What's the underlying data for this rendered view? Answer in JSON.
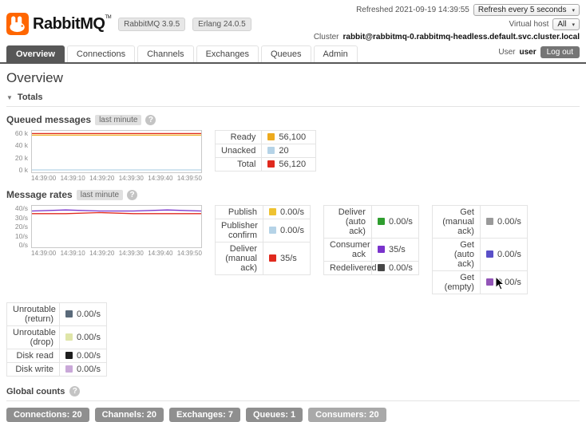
{
  "header": {
    "brand": "RabbitMQ",
    "brand_tm": "TM",
    "version_badge": "RabbitMQ 3.9.5",
    "erlang_badge": "Erlang 24.0.5",
    "refreshed": "Refreshed 2021-09-19 14:39:55",
    "refresh_select": "Refresh every 5 seconds",
    "virtual_host_label": "Virtual host",
    "virtual_host_select": "All",
    "cluster_label": "Cluster",
    "cluster_value": "rabbit@rabbitmq-0.rabbitmq-headless.default.svc.cluster.local",
    "user_label": "User",
    "user_value": "user",
    "logout": "Log out"
  },
  "tabs": [
    {
      "label": "Overview"
    },
    {
      "label": "Connections"
    },
    {
      "label": "Channels"
    },
    {
      "label": "Exchanges"
    },
    {
      "label": "Queues"
    },
    {
      "label": "Admin"
    }
  ],
  "page_title": "Overview",
  "totals": {
    "title": "Totals"
  },
  "queued": {
    "title": "Queued messages",
    "badge": "last minute",
    "help": "?",
    "legend": [
      {
        "label": "Ready",
        "value": "56,100",
        "color": "#edaa1e"
      },
      {
        "label": "Unacked",
        "value": "20",
        "color": "#b5d3e7"
      },
      {
        "label": "Total",
        "value": "56,120",
        "color": "#e02a1e"
      }
    ]
  },
  "rates": {
    "title": "Message rates",
    "badge": "last minute",
    "help": "?",
    "groups": [
      [
        {
          "label": "Publish",
          "value": "0.00/s",
          "color": "#eec231"
        },
        {
          "label": "Publisher confirm",
          "value": "0.00/s",
          "color": "#b5d3e7"
        },
        {
          "label": "Deliver (manual ack)",
          "value": "35/s",
          "color": "#e02a1e"
        }
      ],
      [
        {
          "label": "Deliver (auto ack)",
          "value": "0.00/s",
          "color": "#2f9e2f"
        },
        {
          "label": "Consumer ack",
          "value": "35/s",
          "color": "#7a33cc"
        },
        {
          "label": "Redelivered",
          "value": "0.00/s",
          "color": "#474747"
        }
      ],
      [
        {
          "label": "Get (manual ack)",
          "value": "0.00/s",
          "color": "#9a9a9a"
        },
        {
          "label": "Get (auto ack)",
          "value": "0.00/s",
          "color": "#5a50c8"
        },
        {
          "label": "Get (empty)",
          "value": "0.00/s",
          "color": "#9355b8"
        }
      ]
    ],
    "extra": [
      {
        "label": "Unroutable (return)",
        "value": "0.00/s",
        "color": "#5a6a7a"
      },
      {
        "label": "Unroutable (drop)",
        "value": "0.00/s",
        "color": "#dfe5a8"
      },
      {
        "label": "Disk read",
        "value": "0.00/s",
        "color": "#1e1e1e"
      },
      {
        "label": "Disk write",
        "value": "0.00/s",
        "color": "#c9a8d8"
      }
    ]
  },
  "global_counts": {
    "title": "Global counts",
    "help": "?",
    "badges": [
      {
        "text": "Connections: 20"
      },
      {
        "text": "Channels: 20"
      },
      {
        "text": "Exchanges: 7"
      },
      {
        "text": "Queues: 1"
      },
      {
        "text": "Consumers: 20"
      }
    ]
  },
  "chart_data": [
    {
      "type": "line",
      "title": "Queued messages (last minute)",
      "x": [
        "14:39:00",
        "14:39:10",
        "14:39:20",
        "14:39:30",
        "14:39:40",
        "14:39:50"
      ],
      "ylim": [
        0,
        60000
      ],
      "yticks": [
        "60 k",
        "40 k",
        "20 k",
        "0 k"
      ],
      "series": [
        {
          "name": "Total",
          "color": "#e02a1e",
          "values": [
            56120,
            56120,
            56120,
            56120,
            56120,
            56120
          ]
        },
        {
          "name": "Ready",
          "color": "#edaa1e",
          "values": [
            56100,
            56100,
            56100,
            56100,
            56100,
            56100
          ]
        },
        {
          "name": "Unacked",
          "color": "#b5d3e7",
          "values": [
            20,
            20,
            20,
            20,
            20,
            20
          ]
        }
      ]
    },
    {
      "type": "line",
      "title": "Message rates (last minute)",
      "x": [
        "14:39:00",
        "14:39:10",
        "14:39:20",
        "14:39:30",
        "14:39:40",
        "14:39:50"
      ],
      "ylim": [
        0,
        40
      ],
      "yticks": [
        "40/s",
        "30/s",
        "20/s",
        "10/s",
        "0/s"
      ],
      "series": [
        {
          "name": "Consumer ack",
          "color": "#7a33cc",
          "values": [
            35,
            36,
            35,
            35,
            36,
            35
          ]
        },
        {
          "name": "Deliver (manual ack)",
          "color": "#e02a1e",
          "values": [
            34,
            34,
            35,
            34,
            34,
            34
          ]
        }
      ]
    }
  ]
}
